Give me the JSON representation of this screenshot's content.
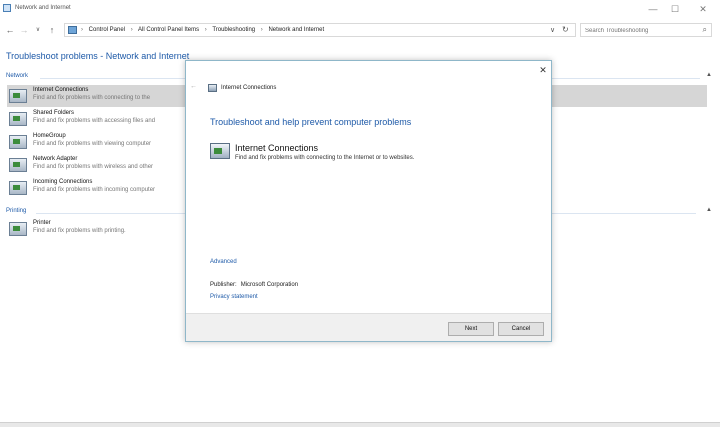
{
  "window": {
    "title": "Network and Internet",
    "controls": {
      "minimize": "—",
      "maximize": "☐",
      "close": "✕"
    }
  },
  "navigation": {
    "back": "←",
    "forward": "→",
    "recent": "∨",
    "up": "↑"
  },
  "address_bar": {
    "breadcrumbs": [
      "Control Panel",
      "All Control Panel Items",
      "Troubleshooting",
      "Network and Internet"
    ],
    "separator": "›",
    "lead_separator": "›",
    "dropdown": "∨",
    "refresh": "↻"
  },
  "search": {
    "placeholder": "Search Troubleshooting",
    "icon": "⌕"
  },
  "page": {
    "title": "Troubleshoot problems - Network and Internet"
  },
  "groups": [
    {
      "label": "Network",
      "collapse_glyph": "▲",
      "items": [
        {
          "name": "Internet Connections",
          "description": "Find and fix problems with connecting to the",
          "selected": true
        },
        {
          "name": "Shared Folders",
          "description": "Find and fix problems with accessing files and",
          "selected": false
        },
        {
          "name": "HomeGroup",
          "description": "Find and fix problems with viewing computer",
          "selected": false
        },
        {
          "name": "Network Adapter",
          "description": "Find and fix problems with wireless and other",
          "selected": false
        },
        {
          "name": "Incoming Connections",
          "description": "Find and fix problems with incoming computer",
          "selected": false
        }
      ]
    },
    {
      "label": "Printing",
      "collapse_glyph": "▲",
      "items": [
        {
          "name": "Printer",
          "description": "Find and fix problems with printing.",
          "selected": false
        }
      ]
    }
  ],
  "dialog": {
    "close": "✕",
    "back": "←",
    "header_title": "Internet Connections",
    "heading": "Troubleshoot and help prevent computer problems",
    "item_name": "Internet Connections",
    "item_description": "Find and fix problems with connecting to the Internet or to websites.",
    "advanced_link": "Advanced",
    "publisher_label": "Publisher:",
    "publisher_value": "Microsoft Corporation",
    "privacy_link": "Privacy statement",
    "next_button": "Next",
    "cancel_button": "Cancel"
  }
}
